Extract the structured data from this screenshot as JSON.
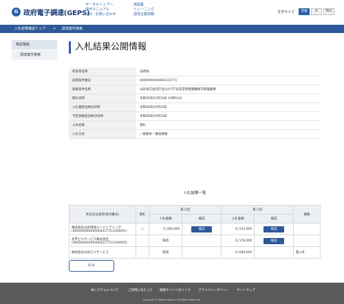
{
  "header": {
    "logo_text": "政府電子調達(GEPS)",
    "links_col1": [
      "ポータルトップへ",
      "操作マニュアル",
      "FAQ・お問い合わせ"
    ],
    "links_col2": [
      "用語集",
      "トレーニング",
      "調達企業情報"
    ],
    "font_size_label": "文字サイズ",
    "font_sizes": [
      "普通",
      "大",
      "特大"
    ]
  },
  "breadcrumb": [
    "入札結果確認トップ",
    "調達案件検索"
  ],
  "sidebar": {
    "heading": "検証機能",
    "items": [
      "調達案件検索"
    ]
  },
  "page_title": "入札結果公開情報",
  "info": [
    {
      "label": "府省等名称",
      "value": "法務省"
    },
    {
      "label": "調達案件番号",
      "value": "0000000000000431771"
    },
    {
      "label": "調達案件名称",
      "value": "山形地方合同庁舎ほか7庁舎非常用発電機保守管理業務"
    },
    {
      "label": "開札日時",
      "value": "令和06年02月19日 10時51分"
    },
    {
      "label": "入札書提出締切日時",
      "value": "令和06年02月19日"
    },
    {
      "label": "予定価格提出締切日時",
      "value": "令和06年02月19日"
    },
    {
      "label": "入札結果",
      "value": "落札"
    },
    {
      "label": "入札方式",
      "value": "一般競争・最低価格"
    }
  ],
  "results": {
    "title": "入札結果一覧",
    "col_company": "商号又は名称(受付番号)",
    "col_winner": "落札",
    "col_round2": "第２回",
    "col_round1": "第１回",
    "col_amount": "入札金額",
    "col_verify": "検証",
    "col_note": "摘要",
    "verify_button": "検証",
    "rows": [
      {
        "company": "株式会社山形環境エンジニアリング",
        "receipt": "(000000000000004317713100001)",
        "winner": "○",
        "amount2": "\\1,482,000",
        "amount1": "\\1,542,000",
        "note": ""
      },
      {
        "company": "太平ビルサービス株式会社",
        "receipt": "(000000000000004317713100002)",
        "winner": "",
        "amount2": "辞退",
        "amount1": "\\1,578,000",
        "note": ""
      },
      {
        "company": "株式会社山形ビルサービス",
        "receipt": "",
        "winner": "",
        "amount2": "辞退",
        "amount1": "\\1,686,000",
        "note": "超入札"
      }
    ]
  },
  "back_button": "戻る",
  "footer": {
    "links": [
      "本システムについて",
      "ご利用にあたって",
      "調達サイトへのリンク",
      "プライバシーポリシー",
      "サイトマップ"
    ],
    "copyright": "Copyright © Digital Agency All Rights Reserved."
  }
}
